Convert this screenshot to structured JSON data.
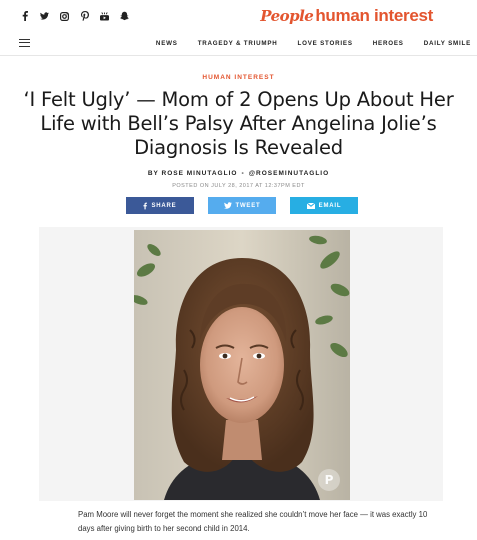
{
  "header": {
    "social_icons": [
      "facebook-icon",
      "twitter-icon",
      "instagram-icon",
      "pinterest-icon",
      "youtube-icon",
      "snapchat-icon"
    ],
    "brand_people": "People",
    "brand_section": "human interest",
    "brand_color": "#e3552f"
  },
  "nav": {
    "items": [
      "NEWS",
      "TRAGEDY & TRIUMPH",
      "LOVE STORIES",
      "HEROES",
      "DAILY SMILE"
    ]
  },
  "article": {
    "category": "HUMAN INTEREST",
    "headline": "‘I Felt Ugly’ — Mom of 2 Opens Up About Her Life with Bell’s Palsy After Angelina Jolie’s Diagnosis Is Revealed",
    "byline_author": "BY ROSE MINUTAGLIO",
    "byline_handle": "@ROSEMINUTAGLIO",
    "byline_separator": "•",
    "posted": "POSTED ON JULY 28, 2017 AT 12:37PM EDT",
    "body_intro": "Pam Moore will never forget the moment she realized she couldn’t move her face — it was exactly 10 days after giving birth to her second child in 2014."
  },
  "share": {
    "facebook_label": "SHARE",
    "twitter_label": "TWEET",
    "email_label": "EMAIL",
    "facebook_color": "#3b5998",
    "twitter_color": "#55acee",
    "email_color": "#27aee3"
  }
}
